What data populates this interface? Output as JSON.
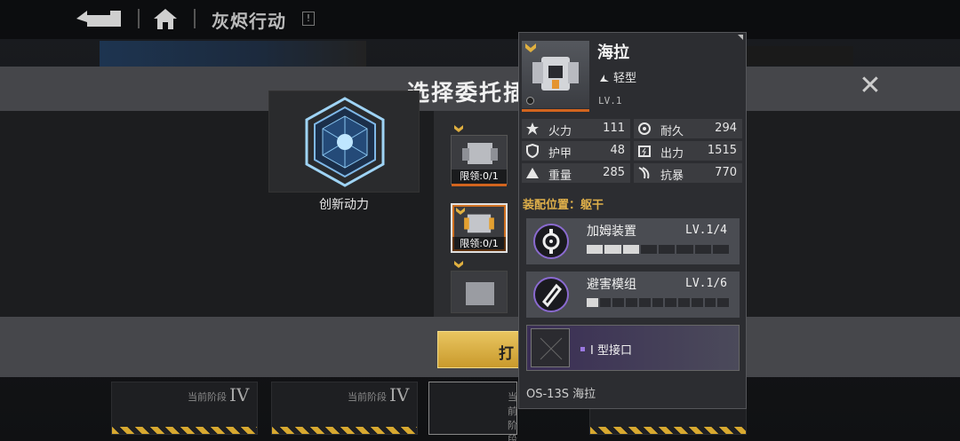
{
  "topbar": {
    "title": "灰烬行动",
    "alert": "!"
  },
  "modal": {
    "title": "选择委托插",
    "core": {
      "name": "创新动力"
    },
    "slots": [
      {
        "limit": "限领:0/1",
        "selected": false
      },
      {
        "limit": "限领:0/1",
        "selected": true
      },
      {
        "limit": "",
        "selected": false
      }
    ],
    "confirm_label": "打"
  },
  "bottom": {
    "cards": [
      {
        "stage_label": "当前阶段",
        "stage": "IV"
      },
      {
        "stage_label": "当前阶段",
        "stage": "IV"
      },
      {
        "stage_label": "当前阶段",
        "stage": ""
      }
    ]
  },
  "unit": {
    "name": "海拉",
    "class": "轻型",
    "level": "LV.1",
    "stats": [
      {
        "label": "火力",
        "value": "111",
        "icon": "firepower-icon"
      },
      {
        "label": "耐久",
        "value": "294",
        "icon": "durability-icon"
      },
      {
        "label": "护甲",
        "value": "48",
        "icon": "armor-icon"
      },
      {
        "label": "出力",
        "value": "1515",
        "icon": "output-icon"
      },
      {
        "label": "重量",
        "value": "285",
        "icon": "weight-icon"
      },
      {
        "label": "抗暴",
        "value": "770",
        "icon": "crit-resist-icon"
      }
    ],
    "equip_position": "装配位置：躯干",
    "modules": [
      {
        "name": "加姆装置",
        "level": "LV.1/4",
        "progress_segments": [
          1,
          1,
          1,
          0,
          0,
          0,
          0,
          0
        ]
      },
      {
        "name": "避害模组",
        "level": "LV.1/6",
        "progress_segments": [
          1,
          0,
          0,
          0,
          0,
          0,
          0,
          0,
          0,
          0,
          0
        ]
      }
    ],
    "interface_slot": "I 型接口",
    "model_id": "OS-13S 海拉"
  }
}
